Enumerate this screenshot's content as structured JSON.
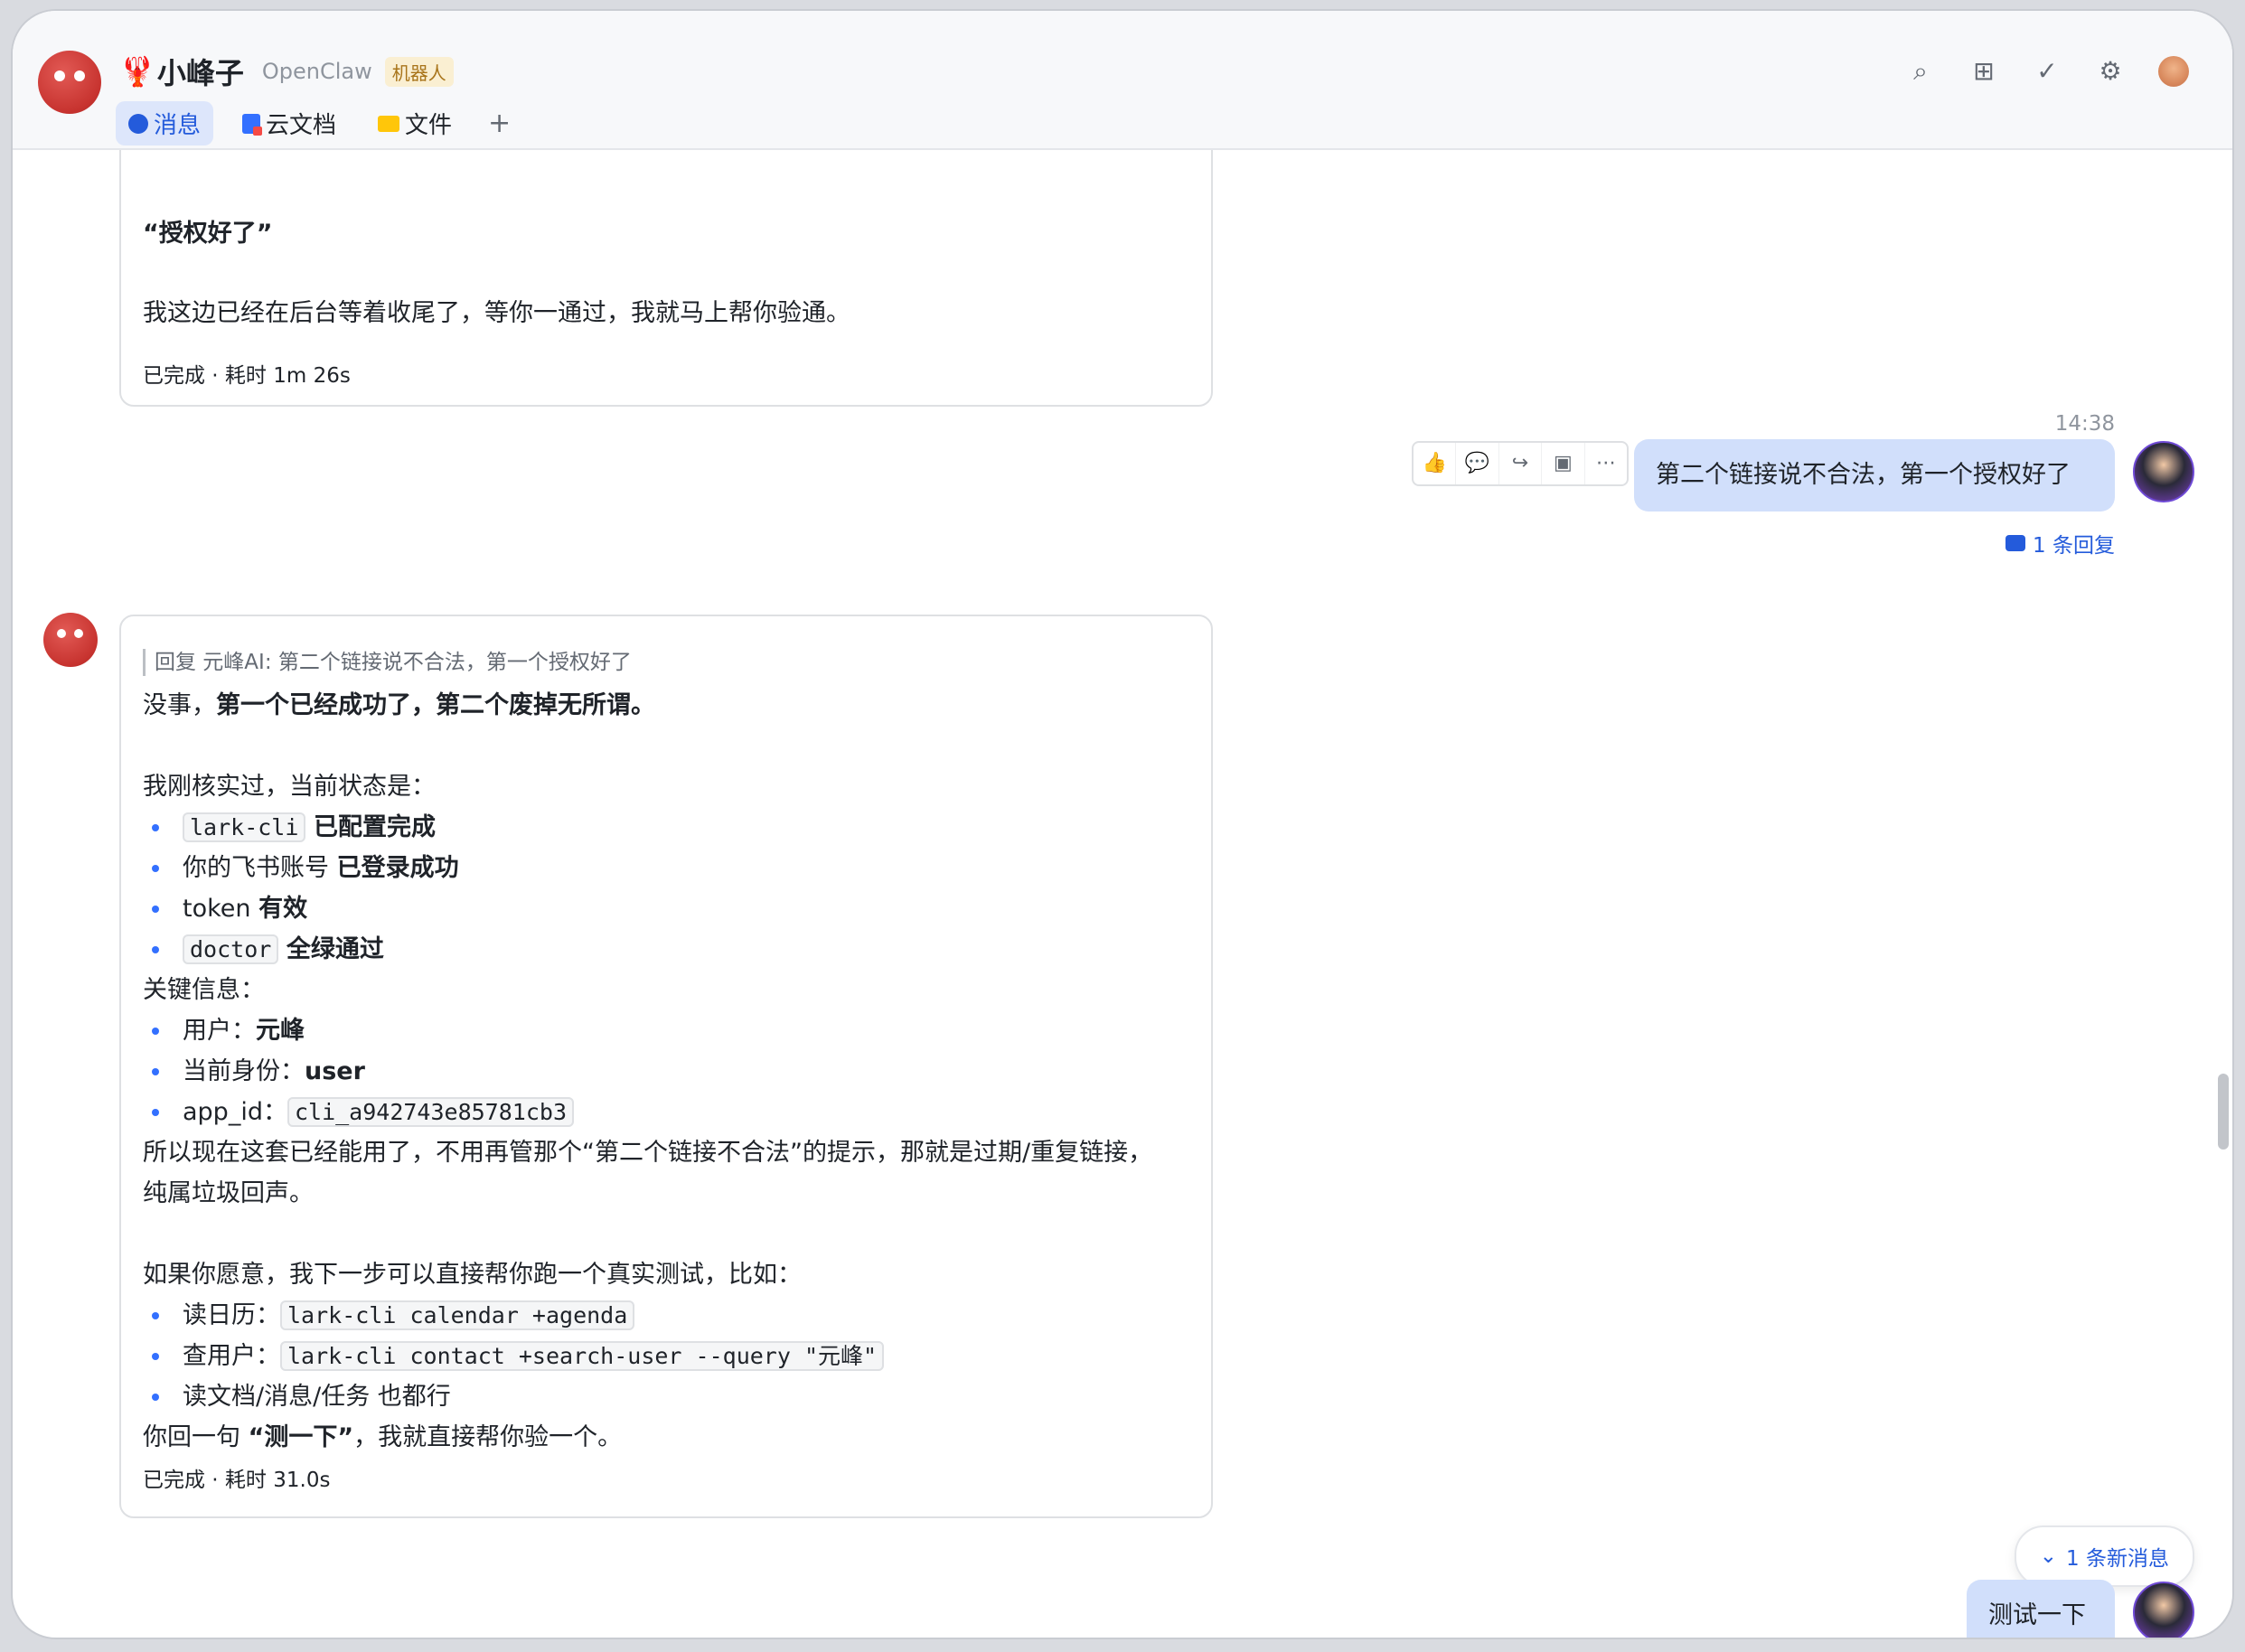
{
  "header": {
    "title": "小峰子",
    "title_emoji": "🦞",
    "subtitle": "OpenClaw",
    "badge": "机器人",
    "tabs": [
      {
        "label": "消息",
        "active": true
      },
      {
        "label": "云文档",
        "active": false
      },
      {
        "label": "文件",
        "active": false
      }
    ],
    "add_tab": "+"
  },
  "toolbar_icons": [
    "search-icon",
    "add-chat-icon",
    "done-icon",
    "settings-icon",
    "user-avatar"
  ],
  "msg1": {
    "lines": [
      "“授权好了”",
      "我这边已经在后台等着收尾了，等你一通过，我就马上帮你验通。"
    ],
    "status": "已完成 · 耗时 1m 26s"
  },
  "user_msg1": {
    "time": "14:38",
    "text": "第二个链接说不合法，第一个授权好了",
    "reply_count": "1 条回复"
  },
  "msg2": {
    "quote": "回复 元峰AI: 第二个链接说不合法，第一个授权好了",
    "intro_a": "没事，",
    "intro_b": "第一个已经成功了，第二个废掉无所谓。",
    "state_head": "我刚核实过，当前状态是：",
    "s1_code": "lark-cli",
    "s1_text": "已配置完成",
    "s2_a": "你的飞书账号",
    "s2_b": "已登录成功",
    "s3_a": "token",
    "s3_b": "有效",
    "s4_code": "doctor",
    "s4_text": "全绿通过",
    "key_head": "关键信息：",
    "k1_a": "用户：",
    "k1_b": "元峰",
    "k2_a": "当前身份：",
    "k2_b": "user",
    "k3_a": "app_id：",
    "k3_code": "cli_a942743e85781cb3",
    "note1": "所以现在这套已经能用了，不用再管那个“第二个链接不合法”的提示，那就是过期/重复链接，",
    "note2": "纯属垃圾回声。",
    "offer": "如果你愿意，我下一步可以直接帮你跑一个真实测试，比如：",
    "o1_a": "读日历：",
    "o1_code": "lark-cli calendar +agenda",
    "o2_a": "查用户：",
    "o2_code": "lark-cli contact +search-user --query \"元峰\"",
    "o3": "读文档/消息/任务 也都行",
    "end_a": "你回一句",
    "end_b": "“测一下”",
    "end_c": "，我就直接帮你验一个。",
    "status": "已完成 · 耗时 31.0s"
  },
  "new_messages": "1 条新消息",
  "user_msg2": {
    "text": "测试一下"
  }
}
